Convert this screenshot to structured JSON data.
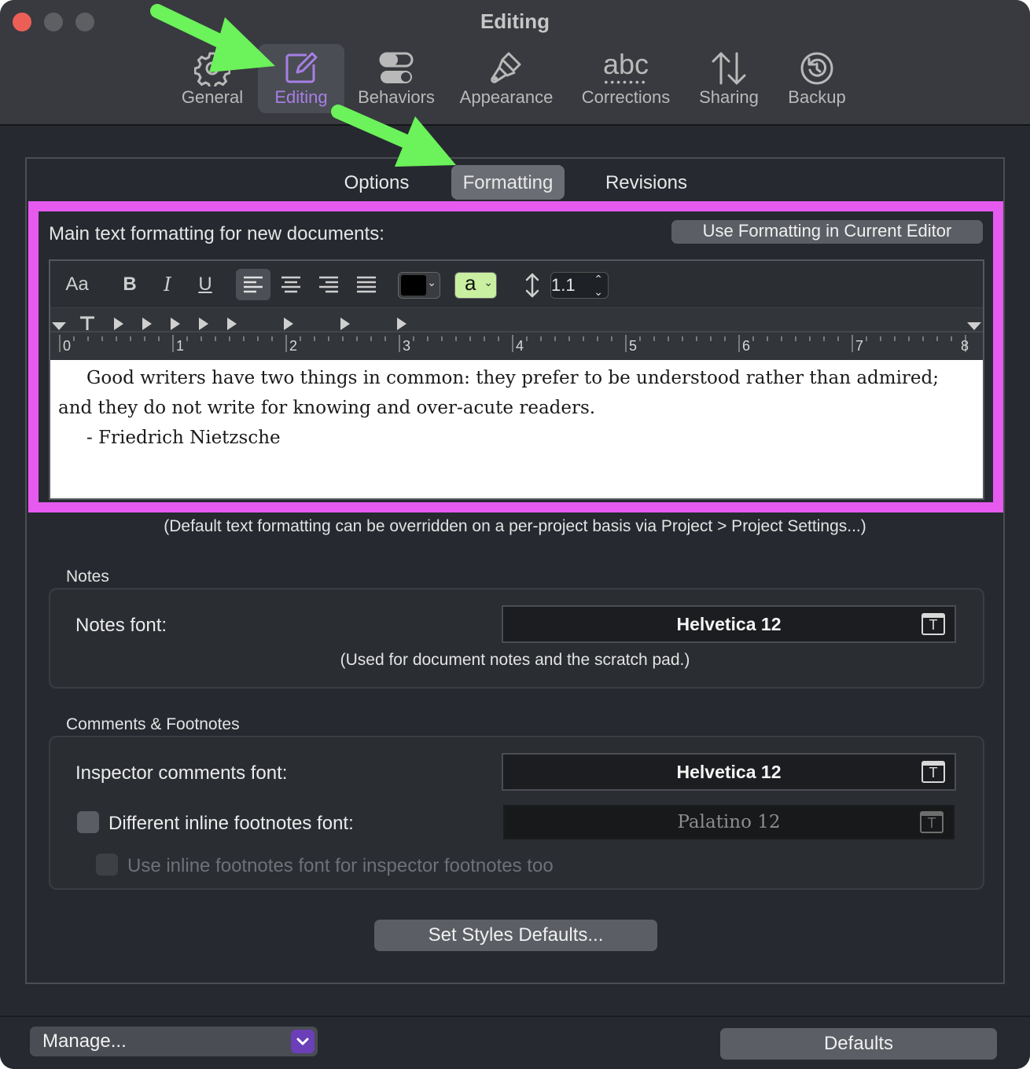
{
  "window": {
    "title": "Editing"
  },
  "toolbar": {
    "items": [
      {
        "label": "General",
        "icon": "gear-icon"
      },
      {
        "label": "Editing",
        "icon": "edit-icon"
      },
      {
        "label": "Behaviors",
        "icon": "toggles-icon"
      },
      {
        "label": "Appearance",
        "icon": "paintbrush-icon"
      },
      {
        "label": "Corrections",
        "icon": "abc-spelling-icon",
        "icon_text": "abc"
      },
      {
        "label": "Sharing",
        "icon": "sync-arrows-icon"
      },
      {
        "label": "Backup",
        "icon": "backup-clock-icon"
      }
    ],
    "selected": "Editing",
    "accent_color": "#a77fe6"
  },
  "tabs": {
    "items": [
      "Options",
      "Formatting",
      "Revisions"
    ],
    "selected": "Formatting"
  },
  "formatting": {
    "title": "Main text formatting for new documents:",
    "use_current_button": "Use Formatting in Current Editor",
    "toolbar": {
      "font_label": "Aa",
      "bold": "B",
      "italic": "I",
      "underline": "U",
      "alignment_selected": "left",
      "text_color": "#000000",
      "highlight_label": "a",
      "highlight_color": "#c8f0a0",
      "line_spacing": "1.1"
    },
    "ruler_numbers": [
      "0",
      "1",
      "2",
      "3",
      "4",
      "5",
      "6",
      "7",
      "8"
    ],
    "sample_text": {
      "line1": "Good writers have two things in common: they prefer to be understood rather than admired; and they do not write for knowing and over-acute readers.",
      "line2": "- Friedrich Nietzsche"
    },
    "highlight_border_color": "#e65af0"
  },
  "default_note": "(Default text formatting can be overridden on a per-project basis via Project > Project Settings...)",
  "notes": {
    "section_label": "Notes",
    "font_label": "Notes font:",
    "font_value": "Helvetica 12",
    "caption": "(Used for document notes and the scratch pad.)"
  },
  "comments": {
    "section_label": "Comments & Footnotes",
    "inspector_label": "Inspector comments font:",
    "inspector_value": "Helvetica 12",
    "inline_label": "Different inline footnotes font:",
    "inline_value": "Palatino 12",
    "inline_checked": false,
    "inspector_footnotes_label": "Use inline footnotes font for inspector footnotes too",
    "inspector_footnotes_checked": false
  },
  "styles_button": "Set Styles Defaults...",
  "footer": {
    "manage_label": "Manage...",
    "defaults_label": "Defaults"
  },
  "annotations": {
    "arrow_color": "#6cf25a"
  }
}
